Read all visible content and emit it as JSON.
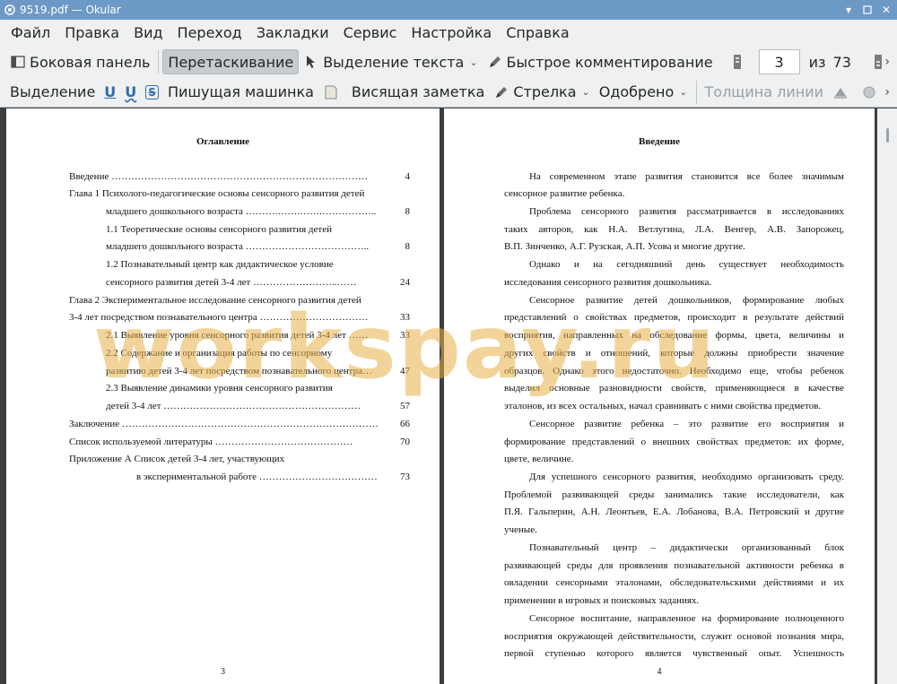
{
  "window": {
    "title": "9519.pdf  — Okular"
  },
  "menubar": {
    "items": [
      "Файл",
      "Правка",
      "Вид",
      "Переход",
      "Закладки",
      "Сервис",
      "Настройка",
      "Справка"
    ]
  },
  "toolbar1": {
    "sidebar": "Боковая панель",
    "drag": "Перетаскивание",
    "text_select": "Выделение текста",
    "quick_comment": "Быстрое комментирование",
    "page_value": "3",
    "of_label": "из",
    "page_total": "73"
  },
  "toolbar2": {
    "selection": "Выделение",
    "underline1": "U",
    "underline2": "U",
    "strike": "S",
    "typewriter": "Пишущая машинка",
    "hanging_note": "Висящая заметка",
    "arrow": "Стрелка",
    "approved": "Одобрено",
    "line_width": "Толщина линии"
  },
  "page_left": {
    "heading": "Оглавление",
    "toc": [
      {
        "text": "Введение ……………………………………………………………………",
        "page": "4"
      },
      {
        "text": "Глава 1 Психолого-педагогические основы сенсорного развития детей",
        "page": ""
      },
      {
        "text": "младшего дошкольного возраста ……….…….…….……………..",
        "page": "8"
      },
      {
        "text": "1.1 Теоретические основы сенсорного развития детей",
        "page": ""
      },
      {
        "text": "младшего дошкольного возраста ………………………………..",
        "page": "8"
      },
      {
        "text": "1.2 Познавательный центр как дидактическое условие",
        "page": ""
      },
      {
        "text": "сенсорного развития детей 3-4 лет ……………………..……",
        "page": "24"
      },
      {
        "text": "Глава 2 Экспериментальное исследование сенсорного развития детей",
        "page": ""
      },
      {
        "text": "3-4 лет посредством познавательного центра ……………………………",
        "page": "33"
      },
      {
        "text": "2.1 Выявление уровня сенсорного развития детей 3-4 лет ……",
        "page": "33"
      },
      {
        "text": "2.2 Содержание и организация работы по сенсорному",
        "page": ""
      },
      {
        "text": "развитию детей 3-4 лет посредством познавательного центра…",
        "page": "47"
      },
      {
        "text": "2.3 Выявление динамики уровня сенсорного развития",
        "page": ""
      },
      {
        "text": "детей 3-4 лет ……………………………………………………",
        "page": "57"
      },
      {
        "text": "Заключение ……………………………………………………………………",
        "page": "66"
      },
      {
        "text": "Список используемой литературы ……………………………………",
        "page": "70"
      },
      {
        "text": "Приложение А Список детей 3-4 лет, участвующих",
        "page": ""
      },
      {
        "text": "в экспериментальной работе ………………………………",
        "page": "73"
      }
    ],
    "page_number": "3"
  },
  "page_right": {
    "heading": "Введение",
    "lines": [
      "На современном этапе развития становится все более значимым",
      "сенсорное развитие ребенка.",
      "Проблема сенсорного развития рассматривается в исследованиях",
      "таких авторов, как Н.А. Ветлугина, Л.А. Венгер, А.В. Запорожец,",
      "В.П. Зинченко, А.Г. Рузская, А.П. Усова и многие другие.",
      "Однако и на сегодняшний день существует необходимость",
      "исследования сенсорного развития дошкольника.",
      "Сенсорное развитие детей дошкольников, формирование любых",
      "представлений о свойствах предметов, происходит в результате действий",
      "восприятия, направленных на обследование формы, цвета, величины и",
      "других свойств и отношений, которые должны приобрести значение",
      "образцов. Однако этого недостаточно. Необходимо еще, чтобы ребенок",
      "выделил основные разновидности свойств, применяющиеся в качестве",
      "эталонов, из всех остальных, начал сравнивать с ними свойства предметов.",
      "Сенсорное развитие ребенка – это развитие его восприятия и",
      "формирование представлений о внешних свойствах предметов: их форме,",
      "цвете, величине.",
      "Для успешного сенсорного развития, необходимо организовать среду.",
      "Проблемой развивающей среды занимались такие исследователи, как",
      "П.Я. Гальперин, А.Н. Леонтьев, Е.А. Лобанова, В.А. Петровский и другие",
      "ученые.",
      "Познавательный центр – дидактически организованный блок",
      "развивающей среды для проявления познавательной активности ребенка в",
      "овладении сенсорными эталонами, обследовательскими действиями и их",
      "применении в игровых и поисковых заданиях.",
      "Сенсорное воспитание, направленное на формирование полноценного",
      "восприятия окружающей действительности, служит основой познания мира,",
      "первой ступенью которого является чувственный опыт. Успешность"
    ],
    "page_number": "4"
  },
  "watermark": "workspay.ru"
}
